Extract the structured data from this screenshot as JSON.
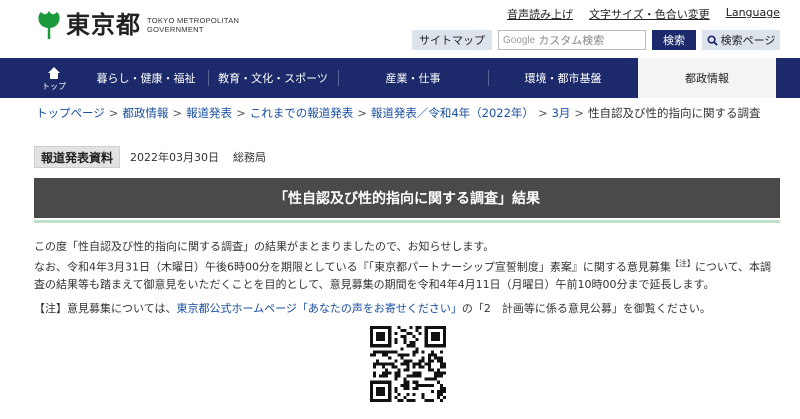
{
  "header": {
    "logo_ja": "東京都",
    "logo_en_line1": "TOKYO METROPOLITAN",
    "logo_en_line2": "GOVERNMENT",
    "util_links": [
      "音声読み上げ",
      "文字サイズ・色合い変更",
      "Language"
    ],
    "sitemap_label": "サイトマップ",
    "search_brand": "Google",
    "search_placeholder": "カスタム検索",
    "search_button": "検索",
    "search_page_button": "検索ページ"
  },
  "nav": {
    "home_label": "トップ",
    "items": [
      "暮らし・健康・福祉",
      "教育・文化・スポーツ",
      "産業・仕事",
      "環境・都市基盤",
      "都政情報"
    ],
    "active_index": 4
  },
  "breadcrumb": {
    "links": [
      "トップページ",
      "都政情報",
      "報道発表",
      "これまでの報道発表",
      "報道発表／令和4年（2022年）",
      "3月"
    ],
    "current": "性自認及び性的指向に関する調査"
  },
  "release": {
    "label": "報道発表資料",
    "date": "2022年03月30日",
    "department": "総務局"
  },
  "title": "「性自認及び性的指向に関する調査」結果",
  "body": {
    "line1": "この度「性自認及び性的指向に関する調査」の結果がまとまりましたので、お知らせします。",
    "line2_a": "なお、令和4年3月31日（木曜日）午後6時00分を期限としている『「東京都パートナーシップ宣誓制度」素案』に関する意見募集",
    "line2_note": "【注】",
    "line2_b": "について、本調",
    "line3": "査の結果等も踏まえて御意見をいただくことを目的として、意見募集の期間を令和4年4月11日（月曜日）午前10時00分まで延長します。"
  },
  "note": {
    "prefix": "【注】意見募集については、",
    "link1": "東京都公式ホームページ「あなたの声をお寄せください」",
    "middle": "の「2　計画等に係る意見公募」を御覧ください。"
  },
  "colors": {
    "nav_bg": "#1c2a6b",
    "title_bar_bg": "#4a4a4a",
    "logo_green": "#1a9a3a",
    "link_blue": "#1a4fa0",
    "accent_line": "#bfe0c6"
  }
}
